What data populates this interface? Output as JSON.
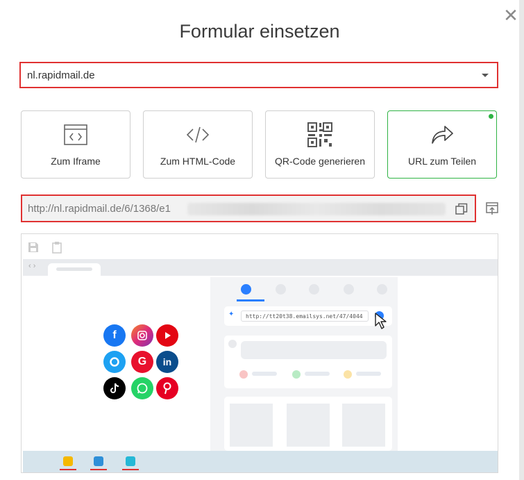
{
  "dialog": {
    "title": "Formular einsetzen",
    "close_icon": "close-icon"
  },
  "domain_select": {
    "value": "nl.rapidmail.de"
  },
  "options": [
    {
      "label": "Zum Iframe",
      "icon": "iframe-icon",
      "active": false
    },
    {
      "label": "Zum HTML-Code",
      "icon": "code-icon",
      "active": false
    },
    {
      "label": "QR-Code generieren",
      "icon": "qr-code-icon",
      "active": false
    },
    {
      "label": "URL zum Teilen",
      "icon": "share-arrow-icon",
      "active": true
    }
  ],
  "share_url": {
    "value": "http://nl.rapidmail.de/6/1368/e1"
  },
  "preview": {
    "browser_url": "http://tt20t38.emailsys.net/47/4044",
    "social_icons": [
      "facebook-icon",
      "instagram-icon",
      "youtube-icon",
      "signal-icon",
      "google-icon",
      "linkedin-icon",
      "tiktok-icon",
      "whatsapp-icon",
      "pinterest-icon"
    ]
  },
  "colors": {
    "highlight": "#e03131",
    "active_option": "#2fb344",
    "accent": "#2a7fff"
  }
}
